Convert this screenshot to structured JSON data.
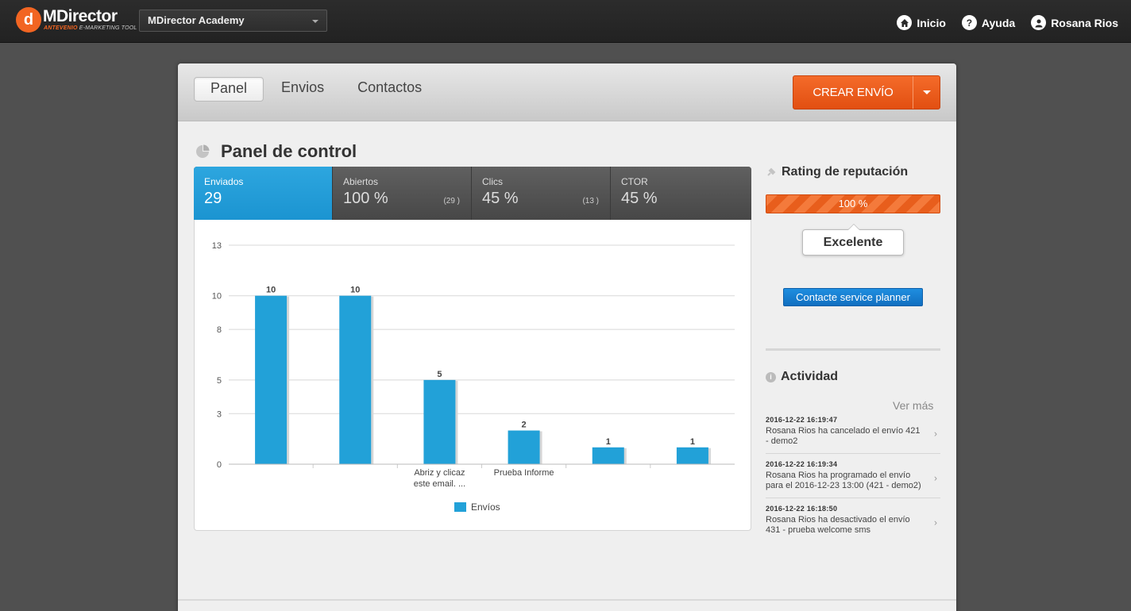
{
  "app": {
    "logo_letter": "d",
    "brand": "MDirector",
    "tagline_brand": "ANTEVENIO",
    "tagline_rest": " E-MARKETING TOOL",
    "account_selected": "MDirector Academy"
  },
  "topnav": {
    "home_label": "Inicio",
    "help_label": "Ayuda",
    "help_glyph": "?",
    "user_label": "Rosana Rios"
  },
  "tabs": {
    "panel": "Panel",
    "envios": "Envios",
    "contactos": "Contactos",
    "active": "Panel"
  },
  "create_button": {
    "label": "CREAR ENVÍO"
  },
  "panel": {
    "title": "Panel de control"
  },
  "stats": [
    {
      "label": "Enviados",
      "value": "29",
      "count": ""
    },
    {
      "label": "Abiertos",
      "value": "100 %",
      "count": "(29 )"
    },
    {
      "label": "Clics",
      "value": "45 %",
      "count": "(13 )"
    },
    {
      "label": "CTOR",
      "value": "45 %",
      "count": ""
    }
  ],
  "chart_data": {
    "type": "bar",
    "categories": [
      "",
      "",
      "Abriz y clicaz este email. ...",
      "Prueba Informe",
      "",
      ""
    ],
    "category_lines": [
      [],
      [],
      [
        "Abriz y clicaz",
        "este email. ..."
      ],
      [
        "Prueba Informe"
      ],
      [],
      []
    ],
    "series": [
      {
        "name": "Envíos",
        "values": [
          10,
          10,
          5,
          2,
          1,
          1
        ]
      }
    ],
    "yticks": [
      0,
      3,
      5,
      8,
      10,
      13
    ],
    "ylim": [
      0,
      13
    ],
    "grid": true,
    "legend_position": "bottom-center",
    "bar_color": "#22a1d8"
  },
  "reputation": {
    "title": "Rating de reputación",
    "value_label": "100 %",
    "value": 100,
    "rating": "Excelente",
    "contact_button": "Contacte service planner"
  },
  "activity": {
    "title": "Actividad",
    "info_glyph": "i",
    "more_label": "Ver más",
    "items": [
      {
        "time": "2016-12-22 16:19:47",
        "text": "Rosana Rios ha cancelado el envío 421 - demo2"
      },
      {
        "time": "2016-12-22 16:19:34",
        "text": "Rosana Rios ha programado el envío para el 2016-12-23 13:00 (421 - demo2)"
      },
      {
        "time": "2016-12-22 16:18:50",
        "text": "Rosana Rios ha desactivado el envío 431 - prueba welcome sms"
      }
    ]
  },
  "colors": {
    "accent_orange": "#f26522",
    "accent_blue": "#1b94d1",
    "planner_blue": "#116fc0"
  },
  "icons": {
    "home": "home-icon",
    "help": "help-icon",
    "user": "user-icon",
    "pie": "pie-chart-icon",
    "pin": "pin-icon",
    "info": "info-icon",
    "chevron": "chevron-right-icon"
  }
}
